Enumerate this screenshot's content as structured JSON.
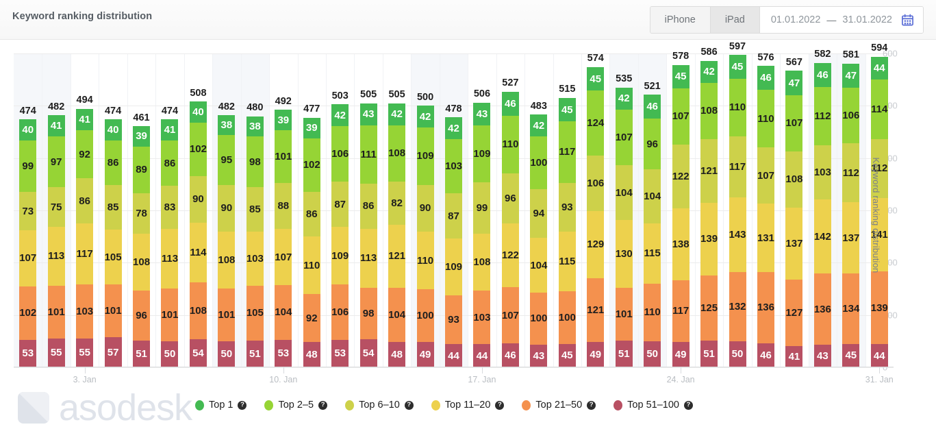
{
  "header": {
    "title": "Keyword ranking distribution",
    "segments": [
      {
        "label": "iPhone",
        "state": "active"
      },
      {
        "label": "iPad",
        "state": "inactive"
      }
    ],
    "date_from": "01.01.2022",
    "date_separator": "—",
    "date_to": "31.01.2022",
    "calendar_icon": "calendar-icon",
    "calendar_icon_color": "#5b6ed6"
  },
  "legend": {
    "items": [
      {
        "label": "Top 1",
        "color": "#43ba52",
        "help": "?"
      },
      {
        "label": "Top 2–5",
        "color": "#96d435",
        "help": "?"
      },
      {
        "label": "Top 6–10",
        "color": "#cdd14a",
        "help": "?"
      },
      {
        "label": "Top 11–20",
        "color": "#edd14d",
        "help": "?"
      },
      {
        "label": "Top 21–50",
        "color": "#f4914e",
        "help": "?"
      },
      {
        "label": "Top 51–100",
        "color": "#b85063",
        "help": "?"
      }
    ]
  },
  "watermark": {
    "text": "asodesk"
  },
  "chart_data": {
    "type": "bar",
    "stacked": true,
    "title": "Keyword ranking distribution",
    "xlabel": "",
    "ylabel": "Keyword ranking distribution",
    "ylim": [
      0,
      600
    ],
    "yticks": [
      0,
      100,
      200,
      300,
      400,
      500,
      600
    ],
    "grid": true,
    "legend_position": "bottom",
    "y_axis_side": "right",
    "x_tick_labels": [
      "3. Jan",
      "10. Jan",
      "17. Jan",
      "24. Jan",
      "31. Jan"
    ],
    "x_tick_indices": [
      2,
      9,
      16,
      23,
      30
    ],
    "weekend_indices": [
      0,
      1,
      7,
      8,
      14,
      15,
      21,
      22,
      28,
      29
    ],
    "weekend_band_color": "#f5f7fa",
    "categories": [
      "1",
      "2",
      "3",
      "4",
      "5",
      "6",
      "7",
      "8",
      "9",
      "10",
      "11",
      "12",
      "13",
      "14",
      "15",
      "16",
      "17",
      "18",
      "19",
      "20",
      "21",
      "22",
      "23",
      "24",
      "25",
      "26",
      "27",
      "28",
      "29",
      "30",
      "31"
    ],
    "series": [
      {
        "name": "Top 1",
        "color": "#43ba52",
        "label_color": "#ffffff",
        "values": [
          40,
          41,
          41,
          40,
          39,
          41,
          40,
          38,
          38,
          39,
          39,
          42,
          43,
          42,
          42,
          42,
          43,
          46,
          42,
          45,
          45,
          42,
          46,
          45,
          42,
          45,
          46,
          47,
          46,
          47,
          44
        ]
      },
      {
        "name": "Top 2-5",
        "color": "#96d435",
        "label_color": "#1e1e1e",
        "values": [
          99,
          97,
          92,
          86,
          89,
          86,
          102,
          95,
          98,
          101,
          102,
          106,
          111,
          108,
          109,
          103,
          109,
          110,
          100,
          117,
          124,
          107,
          96,
          107,
          108,
          110,
          110,
          107,
          112,
          106,
          114
        ]
      },
      {
        "name": "Top 6-10",
        "color": "#cdd14a",
        "label_color": "#1e1e1e",
        "values": [
          73,
          75,
          86,
          85,
          78,
          83,
          90,
          90,
          85,
          88,
          86,
          87,
          86,
          82,
          90,
          87,
          99,
          96,
          94,
          93,
          106,
          104,
          104,
          122,
          121,
          117,
          107,
          108,
          103,
          112,
          112
        ]
      },
      {
        "name": "Top 11-20",
        "color": "#edd14d",
        "label_color": "#1e1e1e",
        "values": [
          107,
          113,
          117,
          105,
          108,
          113,
          114,
          108,
          103,
          107,
          110,
          109,
          113,
          121,
          110,
          109,
          108,
          122,
          104,
          115,
          129,
          130,
          115,
          138,
          139,
          143,
          131,
          137,
          142,
          137,
          141
        ]
      },
      {
        "name": "Top 21-50",
        "color": "#f4914e",
        "label_color": "#1e1e1e",
        "values": [
          102,
          101,
          103,
          101,
          96,
          101,
          108,
          101,
          105,
          104,
          92,
          106,
          98,
          104,
          100,
          93,
          103,
          107,
          100,
          100,
          121,
          101,
          110,
          117,
          125,
          132,
          136,
          127,
          136,
          134,
          139
        ]
      },
      {
        "name": "Top 51-100",
        "color": "#b85063",
        "label_color": "#ffffff",
        "values": [
          53,
          55,
          55,
          57,
          51,
          50,
          54,
          50,
          51,
          53,
          48,
          53,
          54,
          48,
          49,
          44,
          44,
          46,
          43,
          45,
          49,
          51,
          50,
          49,
          51,
          50,
          46,
          41,
          43,
          45,
          44
        ]
      }
    ],
    "totals": [
      474,
      482,
      494,
      474,
      461,
      474,
      508,
      482,
      480,
      492,
      477,
      503,
      505,
      505,
      500,
      478,
      506,
      527,
      483,
      515,
      574,
      535,
      521,
      578,
      586,
      597,
      576,
      567,
      582,
      581,
      594
    ]
  }
}
